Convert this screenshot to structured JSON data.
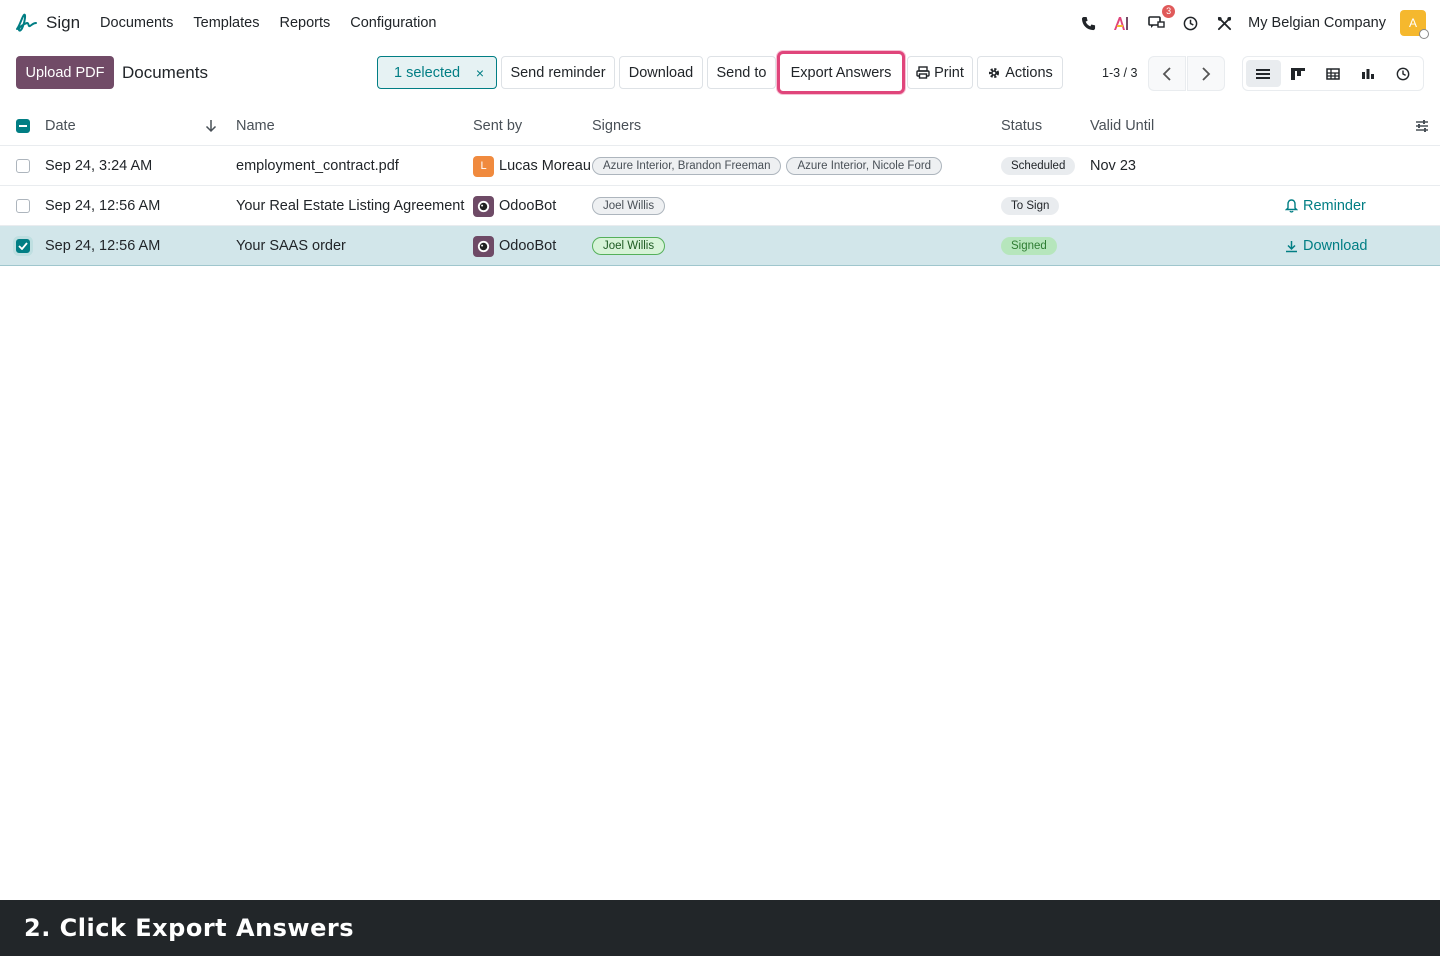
{
  "navbar": {
    "app_name": "Sign",
    "menu": [
      "Documents",
      "Templates",
      "Reports",
      "Configuration"
    ],
    "chat_badge": "3",
    "company": "My Belgian Company",
    "avatar_letter": "A"
  },
  "control": {
    "upload_label": "Upload PDF",
    "breadcrumb": "Documents",
    "selected_label": "1 selected",
    "clear_icon": "×",
    "send_reminder": "Send reminder",
    "download": "Download",
    "send_to": "Send to",
    "export_answers": "Export Answers",
    "print": "Print",
    "actions": "Actions",
    "pager": "1-3 / 3"
  },
  "table": {
    "headers": {
      "date": "Date",
      "name": "Name",
      "sent_by": "Sent by",
      "signers": "Signers",
      "status": "Status",
      "valid_until": "Valid Until"
    },
    "rows": [
      {
        "date": "Sep 24, 3:24 AM",
        "name": "employment_contract.pdf",
        "sender": "Lucas Moreau",
        "sender_initial": "L",
        "signers": [
          "Azure Interior, Brandon Freeman",
          "Azure Interior, Nicole Ford"
        ],
        "status": "Scheduled",
        "valid_until": "Nov 23",
        "action": ""
      },
      {
        "date": "Sep 24, 12:56 AM",
        "name": "Your Real Estate Listing Agreement",
        "sender": "OdooBot",
        "signers": [
          "Joel Willis"
        ],
        "status": "To Sign",
        "valid_until": "",
        "action": "Reminder"
      },
      {
        "date": "Sep 24, 12:56 AM",
        "name": "Your SAAS order",
        "sender": "OdooBot",
        "signers": [
          "Joel Willis"
        ],
        "status": "Signed",
        "valid_until": "",
        "action": "Download"
      }
    ]
  },
  "caption": "2. Click Export Answers",
  "colors": {
    "primary": "#714b67",
    "accent": "#017e84",
    "highlight": "#e0457b"
  }
}
